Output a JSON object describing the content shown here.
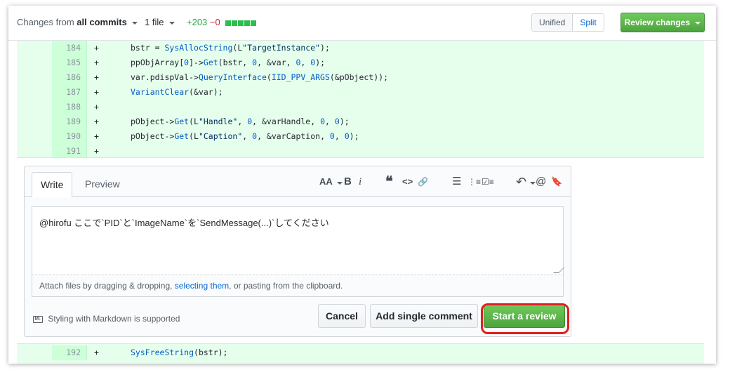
{
  "toolbar": {
    "changes_prefix": "Changes from",
    "changes_value": "all commits",
    "files": "1 file",
    "additions": "+203",
    "deletions": "−0",
    "view_unified": "Unified",
    "view_split": "Split",
    "review_changes": "Review changes"
  },
  "diff_top": [
    {
      "num": "184",
      "sign": "+",
      "code": "bstr = SysAllocString(L\"TargetInstance\");"
    },
    {
      "num": "185",
      "sign": "+",
      "code": "ppObjArray[0]->Get(bstr, 0, &var, 0, 0);"
    },
    {
      "num": "186",
      "sign": "+",
      "code": "var.pdispVal->QueryInterface(IID_PPV_ARGS(&pObject));"
    },
    {
      "num": "187",
      "sign": "+",
      "code": "VariantClear(&var);"
    },
    {
      "num": "188",
      "sign": "+",
      "code": ""
    },
    {
      "num": "189",
      "sign": "+",
      "code": "pObject->Get(L\"Handle\", 0, &varHandle, 0, 0);"
    },
    {
      "num": "190",
      "sign": "+",
      "code": "pObject->Get(L\"Caption\", 0, &varCaption, 0, 0);"
    },
    {
      "num": "191",
      "sign": "+",
      "code": ""
    }
  ],
  "diff_bottom": [
    {
      "num": "192",
      "sign": "+",
      "code": "SysFreeString(bstr);"
    }
  ],
  "comment": {
    "tab_write": "Write",
    "tab_preview": "Preview",
    "text": "@hirofu ここで`PID`と`ImageName`を`SendMessage(...)`してください",
    "attach_prefix": "Attach files by dragging & dropping, ",
    "attach_link": "selecting them",
    "attach_suffix": ", or pasting from the clipboard.",
    "markdown_note": "Styling with Markdown is supported",
    "markdown_badge": "M↓",
    "cancel": "Cancel",
    "add_single": "Add single comment",
    "start_review": "Start a review",
    "tools": {
      "header": "AA",
      "bold": "B",
      "italic": "i",
      "quote": "❝",
      "code": "<>",
      "link": "🔗",
      "ul": "☰",
      "ol": "⋮≡",
      "task": "☑≡",
      "reply": "↶",
      "mention": "@",
      "bookmark": "🔖"
    }
  }
}
